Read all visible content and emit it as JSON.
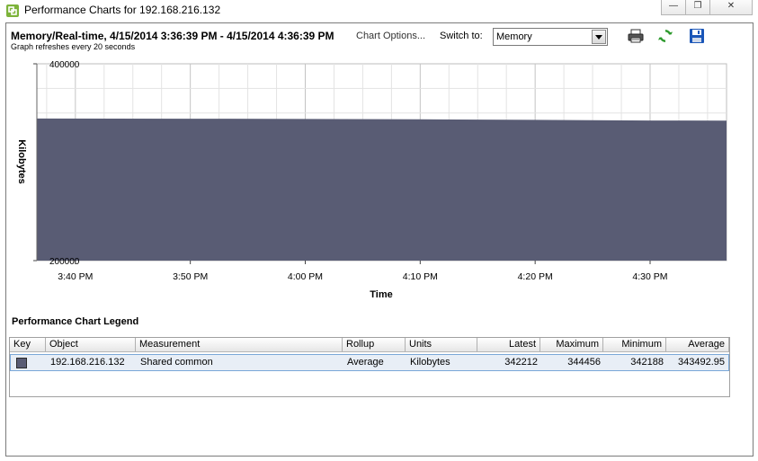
{
  "window": {
    "title": "Performance Charts for 192.168.216.132"
  },
  "header": {
    "chart_title": "Memory/Real-time, 4/15/2014 3:36:39 PM - 4/15/2014 4:36:39 PM",
    "chart_options_link": "Chart Options...",
    "refresh_note": "Graph refreshes every 20 seconds",
    "switch_label": "Switch to:",
    "switch_value": "Memory"
  },
  "chart_data": {
    "type": "area",
    "ylabel": "Kilobytes",
    "xlabel": "Time",
    "ylim": [
      200000,
      400000
    ],
    "y_ticks": [
      "400000",
      "200000"
    ],
    "x_ticks": [
      "3:40 PM",
      "3:50 PM",
      "4:00 PM",
      "4:10 PM",
      "4:20 PM",
      "4:30 PM"
    ],
    "series": [
      {
        "color": "#595c74",
        "x": [
          "3:36:39 PM",
          "3:50 PM",
          "4:00 PM",
          "4:10 PM",
          "4:20 PM",
          "4:30 PM",
          "4:36:39 PM"
        ],
        "values": [
          344456,
          344200,
          344000,
          343600,
          343000,
          342400,
          342212
        ]
      }
    ],
    "grid": true
  },
  "legend": {
    "title": "Performance Chart Legend",
    "columns": [
      "Key",
      "Object",
      "Measurement",
      "Rollup",
      "Units",
      "Latest",
      "Maximum",
      "Minimum",
      "Average"
    ],
    "rows": [
      {
        "object": "192.168.216.132",
        "measurement": "Shared common",
        "rollup": "Average",
        "units": "Kilobytes",
        "latest": "342212",
        "maximum": "344456",
        "minimum": "342188",
        "average": "343492.95"
      }
    ]
  },
  "colors": {
    "series": "#595c74",
    "accent_blue": "#1a56b8",
    "accent_green": "#2e9a2e"
  }
}
